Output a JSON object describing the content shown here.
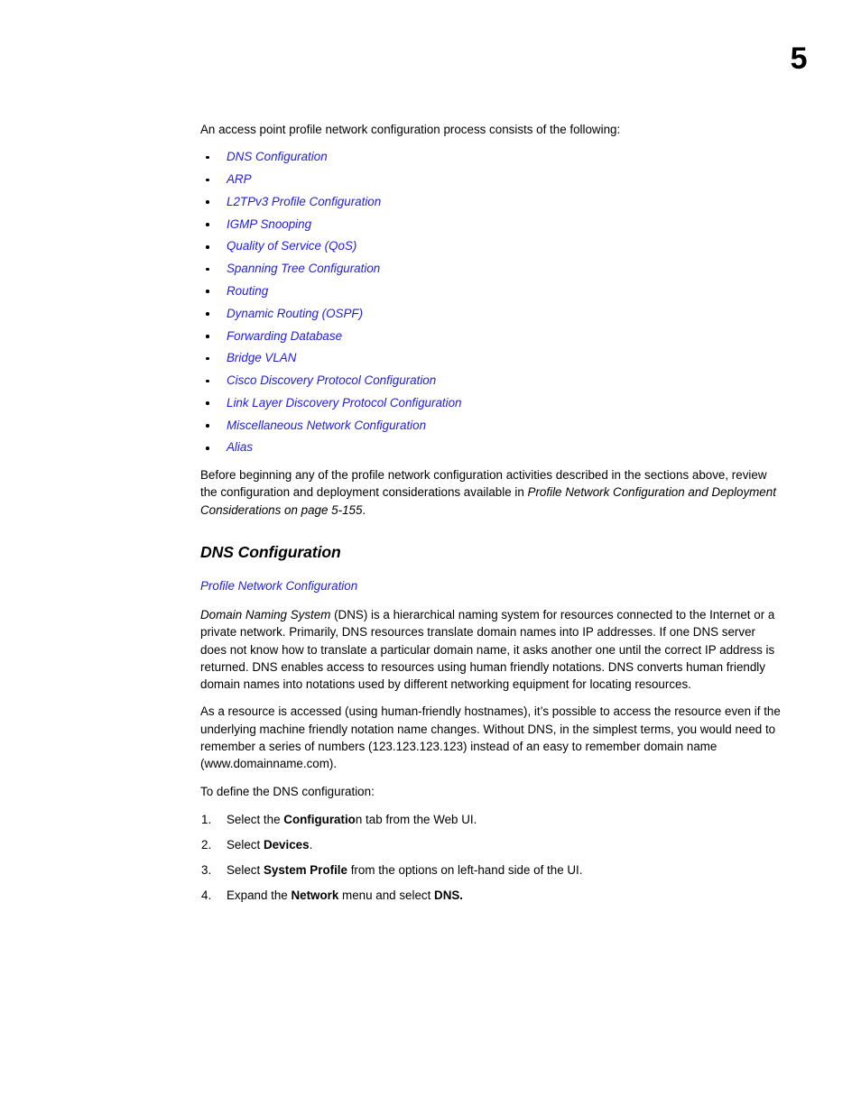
{
  "page": {
    "number": "5"
  },
  "intro": {
    "text": "An access point profile network configuration process consists of the following:"
  },
  "bullets": [
    {
      "label": "DNS Configuration"
    },
    {
      "label": "ARP"
    },
    {
      "label": "L2TPv3 Profile Configuration"
    },
    {
      "label": "IGMP Snooping"
    },
    {
      "label": "Quality of Service (QoS)"
    },
    {
      "label": "Spanning Tree Configuration"
    },
    {
      "label": "Routing"
    },
    {
      "label": "Dynamic Routing (OSPF)"
    },
    {
      "label": "Forwarding Database"
    },
    {
      "label": "Bridge VLAN"
    },
    {
      "label": "Cisco Discovery Protocol Configuration"
    },
    {
      "label": "Link Layer Discovery Protocol Configuration"
    },
    {
      "label": "Miscellaneous Network Configuration"
    },
    {
      "label": "Alias"
    }
  ],
  "note": {
    "lead": "Before beginning any of the profile network configuration activities described in the sections above, review the configuration and deployment considerations available in ",
    "xref": "Profile Network Configuration and Deployment Considerations on page 5-155",
    "tail": "."
  },
  "section": {
    "heading": "DNS Configuration",
    "link": "Profile Network Configuration",
    "paragraph1_italic_lead": "Domain Naming System",
    "paragraph1_rest": " (DNS) is a hierarchical naming system for resources connected to the Internet or a private network. Primarily, DNS resources translate domain names into IP addresses. If one DNS server does not know how to translate a particular domain name, it asks another one until the correct IP address is returned. DNS enables access to resources using human friendly notations. DNS converts human friendly domain names into notations used by different networking equipment for locating resources.",
    "paragraph2": "As a resource is accessed (using human-friendly hostnames), it’s possible to access the resource even if the underlying machine friendly notation name changes. Without DNS, in the simplest terms, you would need to remember a series of numbers (123.123.123.123) instead of an easy to remember domain name (www.domainname.com).",
    "paragraph3": "To define the DNS configuration:"
  },
  "steps": [
    {
      "pre": "Select the ",
      "bold": "Configuratio",
      "post": "n tab from the Web UI."
    },
    {
      "pre": "Select ",
      "bold": "Devices",
      "post": "."
    },
    {
      "pre": "Select ",
      "bold": "System Profile",
      "post": " from the options on left-hand side of the UI."
    },
    {
      "pre": "Expand the ",
      "bold": "Network",
      "post": " menu and select ",
      "bold2": "DNS."
    }
  ],
  "colors": {
    "link": "#2420d6",
    "text": "#000000",
    "background": "#ffffff"
  }
}
